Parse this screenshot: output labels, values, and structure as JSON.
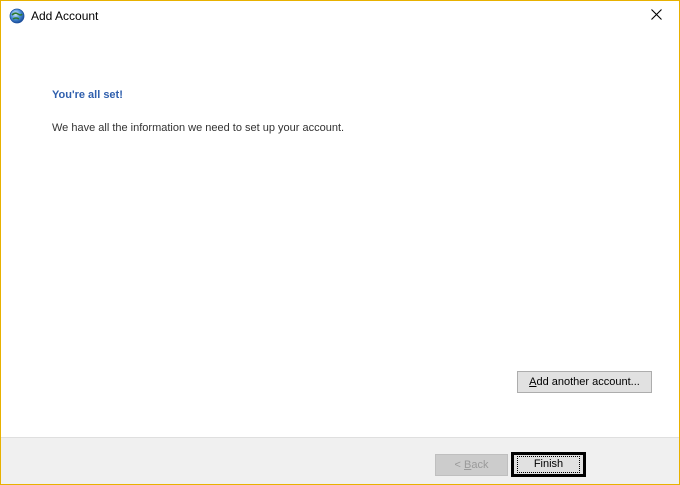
{
  "window": {
    "title": "Add Account",
    "icon": "outlook-globe-icon",
    "close_icon": "close-icon",
    "accent_border_color": "#e8b100"
  },
  "content": {
    "heading": "You're all set!",
    "heading_color": "#2f5fad",
    "message": "We have all the information we need to set up your account.",
    "add_another_button": {
      "accelerator": "A",
      "rest": "dd another account..."
    }
  },
  "footer": {
    "back_button": {
      "prefix": "< ",
      "accelerator": "B",
      "rest": "ack",
      "enabled": false
    },
    "finish_button": {
      "label": "Finish",
      "focused": true
    }
  }
}
